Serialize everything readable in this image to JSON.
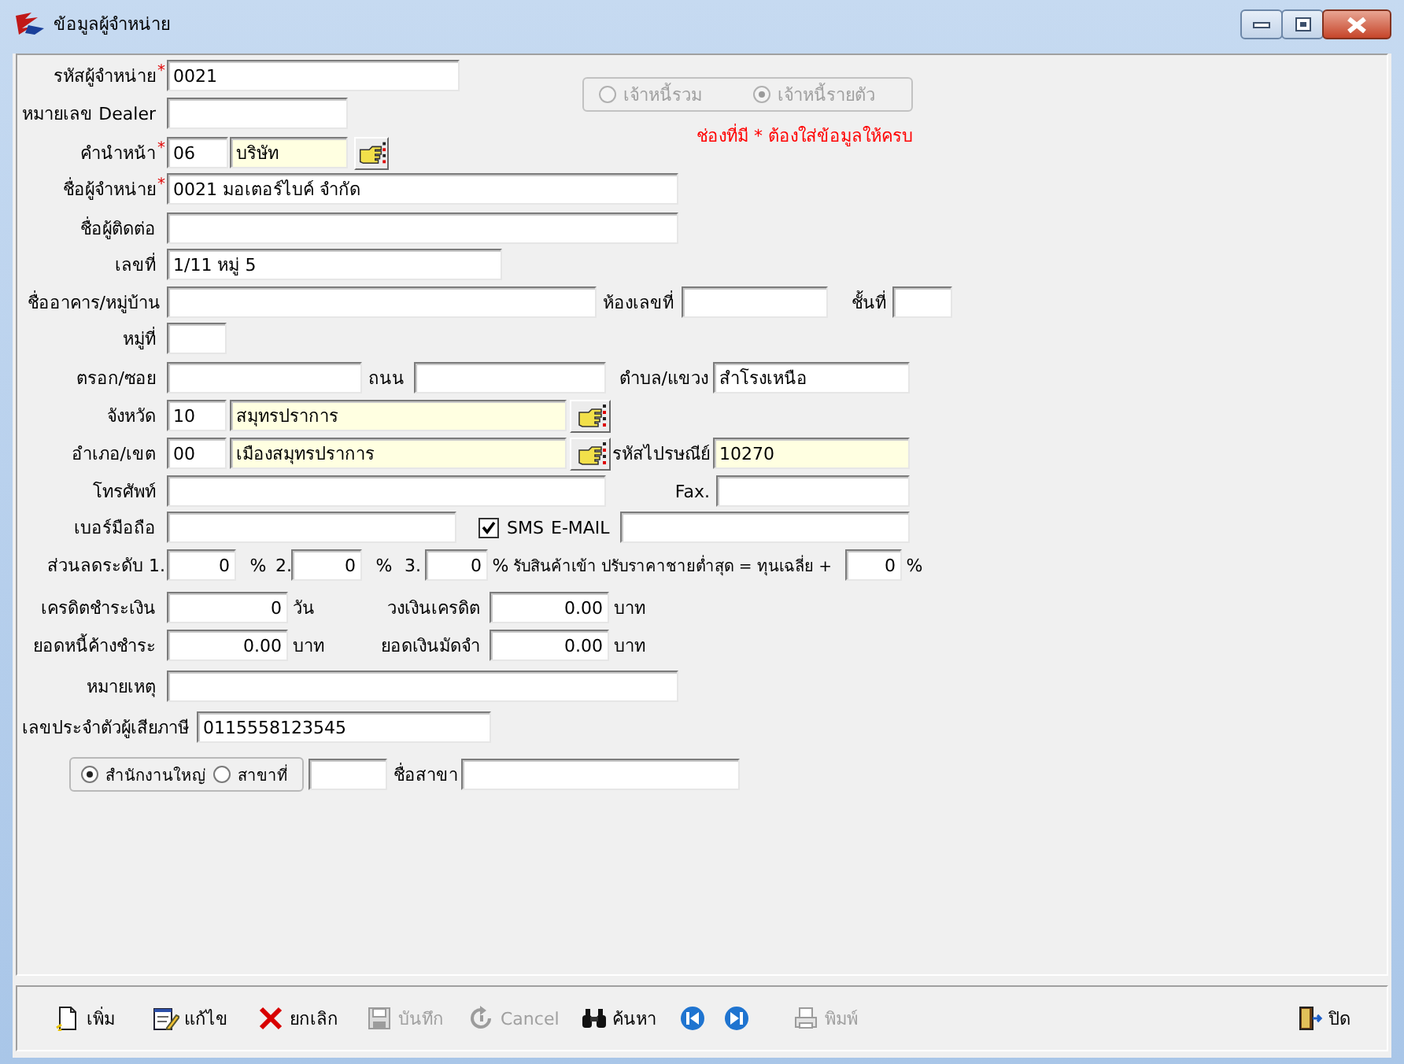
{
  "window": {
    "title": "ข้อมูลผู้จำหน่าย"
  },
  "creditor_type": [
    {
      "label": "เจ้าหนี้รวม",
      "selected": false,
      "disabled": true
    },
    {
      "label": "เจ้าหนี้รายตัว",
      "selected": true,
      "disabled": true
    }
  ],
  "required_note": "ช่องที่มี * ต้องใส่ข้อมูลให้ครบ",
  "form_rows": [
    {
      "items": [
        {
          "kind": "label",
          "text": "รหัสผู้จำหน่าย",
          "mark": "*"
        },
        {
          "kind": "field",
          "value": "0021",
          "highlighted": false
        }
      ]
    },
    {
      "items": [
        {
          "kind": "label",
          "text": "หมายเลข Dealer"
        },
        {
          "kind": "field",
          "highlighted": false
        }
      ]
    },
    {
      "items": [
        {
          "kind": "label",
          "text": "คำนำหน้า",
          "mark": "*"
        },
        {
          "kind": "field",
          "value": "06",
          "highlighted": false
        },
        {
          "kind": "field",
          "value": "บริษัท",
          "highlighted": true
        },
        {
          "kind": "lookup"
        }
      ]
    },
    {
      "items": [
        {
          "kind": "label",
          "text": "ชื่อผู้จำหน่าย",
          "mark": "*"
        },
        {
          "kind": "field",
          "value": "0021 มอเตอร์ไบค์ จำกัด",
          "highlighted": false
        }
      ]
    },
    {
      "items": [
        {
          "kind": "label",
          "text": "ชื่อผู้ติดต่อ"
        },
        {
          "kind": "field",
          "highlighted": false
        }
      ]
    },
    {
      "items": [
        {
          "kind": "label",
          "text": "เลขที่"
        },
        {
          "kind": "field",
          "value": "1/11 หมู่ 5",
          "highlighted": false
        }
      ]
    },
    {
      "items": [
        {
          "kind": "label",
          "text": "ชื่ออาคาร/หมู่บ้าน"
        },
        {
          "kind": "field",
          "highlighted": false
        },
        {
          "kind": "label",
          "text": "ห้องเลขที่"
        },
        {
          "kind": "field",
          "highlighted": false
        },
        {
          "kind": "label",
          "text": "ชั้นที่"
        },
        {
          "kind": "field",
          "highlighted": false
        }
      ]
    },
    {
      "items": [
        {
          "kind": "label",
          "text": "หมู่ที่"
        },
        {
          "kind": "field",
          "highlighted": false
        }
      ]
    },
    {
      "items": [
        {
          "kind": "label",
          "text": "ตรอก/ซอย"
        },
        {
          "kind": "field",
          "highlighted": false
        },
        {
          "kind": "label",
          "text": "ถนน"
        },
        {
          "kind": "field",
          "highlighted": false
        },
        {
          "kind": "label",
          "text": "ตำบล/แขวง"
        },
        {
          "kind": "field",
          "value": "สำโรงเหนือ",
          "highlighted": false
        }
      ]
    },
    {
      "items": [
        {
          "kind": "label",
          "text": "จังหวัด"
        },
        {
          "kind": "field",
          "value": "10",
          "highlighted": false
        },
        {
          "kind": "field",
          "value": "สมุทรปราการ",
          "highlighted": true
        },
        {
          "kind": "lookup"
        }
      ]
    },
    {
      "items": [
        {
          "kind": "label",
          "text": "อำเภอ/เขต"
        },
        {
          "kind": "field",
          "value": "00",
          "highlighted": false
        },
        {
          "kind": "field",
          "value": "เมืองสมุทรปราการ",
          "highlighted": true
        },
        {
          "kind": "lookup"
        },
        {
          "kind": "label",
          "text": "รหัสไปรษณีย์"
        },
        {
          "kind": "field",
          "value": "10270",
          "highlighted": true
        }
      ]
    },
    {
      "items": [
        {
          "kind": "label",
          "text": "โทรศัพท์"
        },
        {
          "kind": "field",
          "highlighted": false
        },
        {
          "kind": "label",
          "text": "Fax."
        },
        {
          "kind": "field",
          "highlighted": false
        }
      ]
    },
    {
      "items": [
        {
          "kind": "label",
          "text": "เบอร์มือถือ"
        },
        {
          "kind": "field",
          "highlighted": false
        },
        {
          "kind": "checkbox",
          "label": "SMS",
          "checked": true
        },
        {
          "kind": "label",
          "text": "E-MAIL"
        },
        {
          "kind": "field",
          "highlighted": false
        }
      ]
    },
    {
      "items": [
        {
          "kind": "label",
          "text": "ส่วนลดระดับ 1."
        },
        {
          "kind": "number_field",
          "value": "0",
          "highlighted": false
        },
        {
          "kind": "label",
          "text": "%"
        },
        {
          "kind": "label",
          "text": "2."
        },
        {
          "kind": "number_field",
          "value": "0",
          "highlighted": false
        },
        {
          "kind": "label",
          "text": "%"
        },
        {
          "kind": "label",
          "text": "3."
        },
        {
          "kind": "number_field",
          "value": "0",
          "highlighted": false
        },
        {
          "kind": "label",
          "text": "%"
        },
        {
          "kind": "label",
          "text": "รับสินค้าเข้า ปรับราคาชายต่ำสุด = ทุนเฉลี่ย +"
        },
        {
          "kind": "number_field",
          "value": "0",
          "highlighted": false
        },
        {
          "kind": "label",
          "text": "%"
        }
      ]
    },
    {
      "items": [
        {
          "kind": "label",
          "text": "เครดิตชำระเงิน"
        },
        {
          "kind": "number_field",
          "value": "0",
          "highlighted": false
        },
        {
          "kind": "label",
          "text": "วัน"
        },
        {
          "kind": "label",
          "text": "วงเงินเครดิต"
        },
        {
          "kind": "number_field",
          "value": "0.00",
          "highlighted": false
        },
        {
          "kind": "label",
          "text": "บาท"
        }
      ]
    },
    {
      "items": [
        {
          "kind": "label",
          "text": "ยอดหนี้ค้างชำระ"
        },
        {
          "kind": "number_field",
          "value": "0.00",
          "highlighted": false
        },
        {
          "kind": "label",
          "text": "บาท"
        },
        {
          "kind": "label",
          "text": "ยอดเงินมัดจำ"
        },
        {
          "kind": "number_field",
          "value": "0.00",
          "highlighted": false
        },
        {
          "kind": "label",
          "text": "บาท"
        }
      ]
    },
    {
      "items": [
        {
          "kind": "label",
          "text": "หมายเหตุ"
        },
        {
          "kind": "field",
          "highlighted": false
        }
      ]
    },
    {
      "items": [
        {
          "kind": "label",
          "text": "เลขประจำตัวผู้เสียภาษี"
        },
        {
          "kind": "field",
          "value": "0115558123545",
          "highlighted": false
        }
      ]
    },
    {
      "items": [
        {
          "kind": "radio_group",
          "options": [
            {
              "label": "สำนักงานใหญ่",
              "selected": true
            },
            {
              "label": "สาขาที่",
              "selected": false
            }
          ]
        },
        {
          "kind": "field",
          "highlighted": false
        },
        {
          "kind": "label",
          "text": "ชื่อสาขา"
        },
        {
          "kind": "field",
          "highlighted": false
        }
      ]
    }
  ],
  "toolbar": [
    {
      "kind": "button",
      "label": "เพิ่ม",
      "disabled": false
    },
    {
      "kind": "button",
      "label": "แก้ไข",
      "disabled": false
    },
    {
      "kind": "button",
      "label": "ยกเลิก",
      "disabled": false
    },
    {
      "kind": "button",
      "label": "บันทึก",
      "disabled": true
    },
    {
      "kind": "button",
      "label": "Cancel",
      "disabled": true
    },
    {
      "kind": "button",
      "label": "ค้นหา",
      "disabled": false
    },
    {
      "kind": "nav",
      "disabled": false
    },
    {
      "kind": "nav",
      "disabled": false
    },
    {
      "kind": "button",
      "label": "พิมพ์",
      "disabled": true
    },
    {
      "kind": "button",
      "label": "ปิด",
      "disabled": false
    }
  ]
}
